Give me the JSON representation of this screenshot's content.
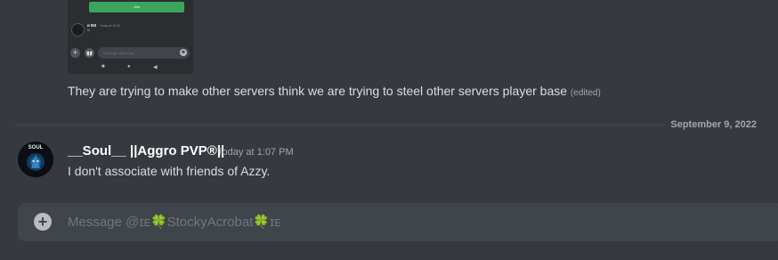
{
  "attachment": {
    "button_label": "Join",
    "author": "ɑ NS",
    "time": "Today at 10:24",
    "message": "hi",
    "add_icon": "+",
    "gift_icon": "gift-icon",
    "input_placeholder": "Message @Deemix",
    "emoji_icon": "☻",
    "nav_home": "■",
    "nav_circle": "●",
    "nav_back": "◀"
  },
  "messages": [
    {
      "text": "They are trying to make other servers think we are trying to steel other servers player base",
      "edited": "(edited)"
    }
  ],
  "date_divider": "September 9, 2022",
  "message_group": {
    "author": "__Soul__ ||Aggro PVP®||",
    "timestamp": "Today at 1:07 PM",
    "text": "I don't associate with friends of Azzy.",
    "avatar_label": "SOUL"
  },
  "composer": {
    "placeholder": "Message @ɪᴇ🍀StockyAcrobat🍀ɪᴇ",
    "add_icon": "+"
  },
  "colors": {
    "background": "#36393f",
    "composer": "#40444b",
    "green_button": "#3ba55c",
    "username": "#ffffff",
    "muted": "#a3a6aa"
  }
}
